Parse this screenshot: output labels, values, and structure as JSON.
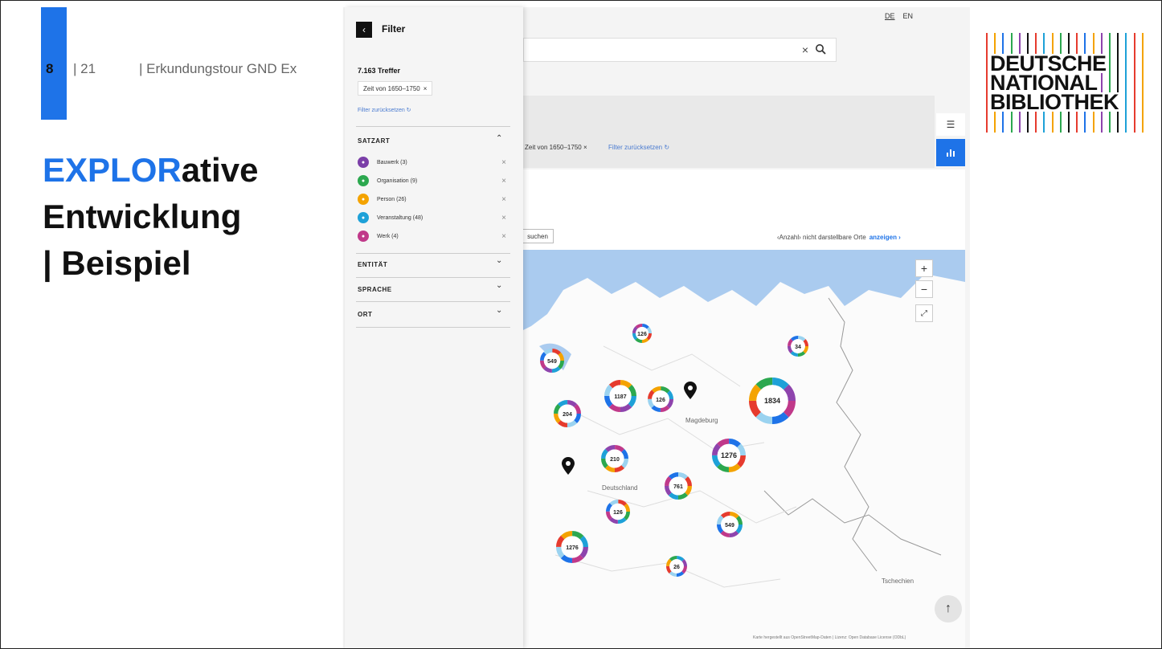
{
  "slide": {
    "number": "8",
    "total": "| 21",
    "topic": "| Erkundungstour  GND  Ex",
    "heading_blue": "EXPLOR",
    "heading_rest": "ative",
    "heading_line2": "Entwicklung",
    "heading_line3": "| Beispiel"
  },
  "logo": {
    "line1": "DEUTSCHE",
    "line2": "NATIONAL",
    "line3": "BIBLIOTHEK",
    "stripe_colors": [
      "#e63b2e",
      "#f4a300",
      "#1e73e8",
      "#2ca84f",
      "#8e44ad",
      "#111111",
      "#e63b2e",
      "#1ea1d8",
      "#f4a300",
      "#2ca84f",
      "#111111",
      "#e63b2e",
      "#1e73e8",
      "#f4a300",
      "#8e44ad",
      "#2ca84f",
      "#111111",
      "#1ea1d8",
      "#e63b2e",
      "#f4a300"
    ]
  },
  "app": {
    "lang_de": "DE",
    "lang_en": "EN",
    "search_clear": "×",
    "search_icon": "search-icon",
    "filter_chip": "Zeit von 1650–1750  ×",
    "filter_reset": "Filter zurücksetzen ↻",
    "suchen": "suchen",
    "hidden_places_text": "‹Anzahl› nicht darstellbare Orte",
    "hidden_places_link": "anzeigen ›",
    "zoom_in": "+",
    "zoom_out": "−",
    "fullscreen": "⤢",
    "scroll_top": "↑",
    "attribution": "Karte hergestellt aus OpenStreetMap-Daten | Lizenz: Open Database License (ODbL)"
  },
  "filter": {
    "back": "‹",
    "title": "Filter",
    "hits": "7.163 Treffer",
    "chip": "Zeit von 1650–1750",
    "chip_remove": "×",
    "reset": "Filter zurücksetzen ↻",
    "sections": {
      "satzart": "SATZART",
      "entitaet": "ENTITÄT",
      "sprache": "SPRACHE",
      "ort": "ORT"
    },
    "chev_up": "⌃",
    "chev_down": "⌄",
    "items": [
      {
        "label": "Bauwerk (3)",
        "color": "#7b3fa8",
        "icon": "building-icon"
      },
      {
        "label": "Organisation (9)",
        "color": "#2ca84f",
        "icon": "organisation-icon"
      },
      {
        "label": "Person (26)",
        "color": "#f4a300",
        "icon": "person-icon"
      },
      {
        "label": "Veranstaltung (48)",
        "color": "#1ea1d8",
        "icon": "event-icon"
      },
      {
        "label": "Werk (4)",
        "color": "#c0398a",
        "icon": "work-icon"
      }
    ]
  },
  "map": {
    "clusters": [
      {
        "label": "126"
      },
      {
        "label": "34"
      },
      {
        "label": "549"
      },
      {
        "label": "1187"
      },
      {
        "label": "126"
      },
      {
        "label": "1834"
      },
      {
        "label": "204"
      },
      {
        "label": "210"
      },
      {
        "label": "1276"
      },
      {
        "label": "761"
      },
      {
        "label": "126"
      },
      {
        "label": "549"
      },
      {
        "label": "1276"
      },
      {
        "label": "26"
      }
    ],
    "places": [
      "Magdeburg",
      "Deutschland",
      "Tschechien"
    ]
  }
}
